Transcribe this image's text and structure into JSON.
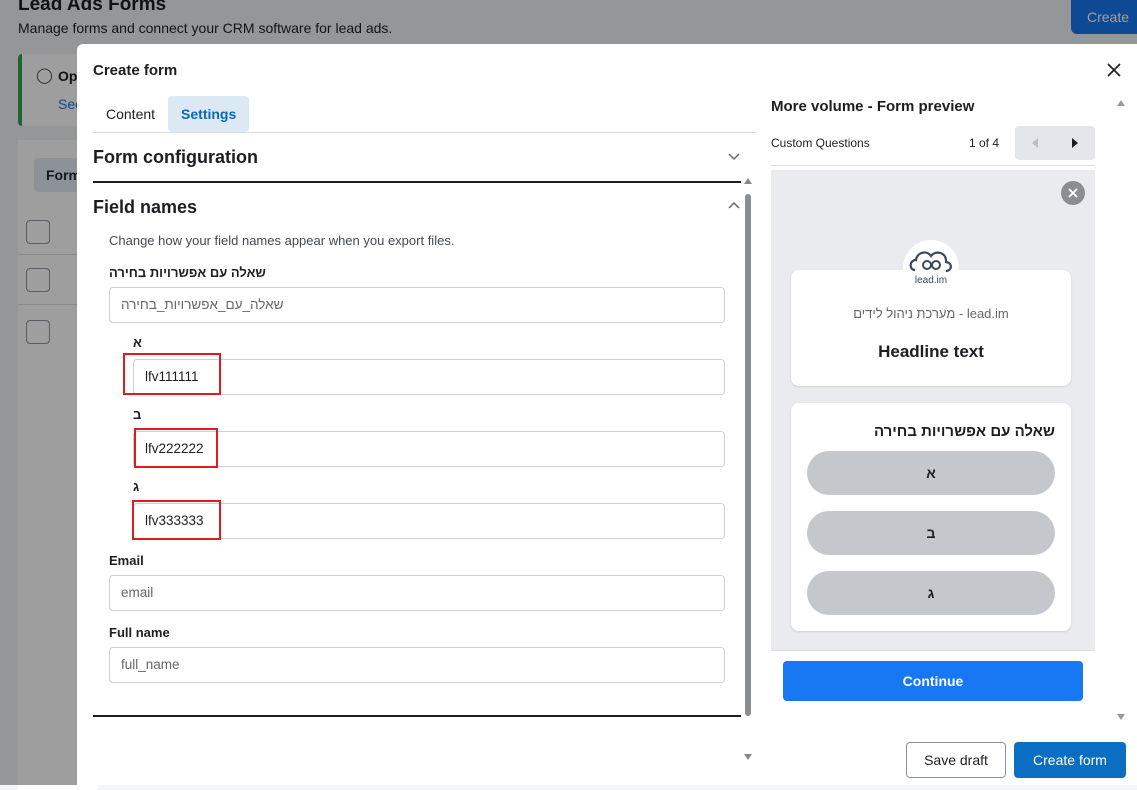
{
  "background": {
    "title": "Lead Ads Forms",
    "subtitle": "Manage forms and connect your CRM software for lead ads.",
    "create_button": "Create",
    "tip_title": "Op",
    "tip_link": "See",
    "table_tab": "Form"
  },
  "modal": {
    "title": "Create form",
    "close_icon": "close-icon",
    "tabs": [
      {
        "label": "Content",
        "active": false
      },
      {
        "label": "Settings",
        "active": true
      }
    ]
  },
  "settings": {
    "form_configuration": "Form configuration",
    "field_names": "Field names",
    "help_text": "Change how your field names appear when you export files.",
    "question": {
      "label": "שאלה עם אפשרויות בחירה",
      "placeholder": "שאלה_עם_אפשרויות_בחירה",
      "options": [
        {
          "label": "א",
          "value": "lfv111111"
        },
        {
          "label": "ב",
          "value": "lfv222222"
        },
        {
          "label": "ג",
          "value": "lfv333333"
        }
      ]
    },
    "email": {
      "label": "Email",
      "placeholder": "email"
    },
    "full_name": {
      "label": "Full name",
      "placeholder": "full_name"
    }
  },
  "preview": {
    "title": "More volume - Form preview",
    "section": "Custom Questions",
    "page": "1 of 4",
    "brand": "מערכת ניהול לידים - lead.im",
    "logo_text": "lead.im",
    "headline": "Headline text",
    "question": "שאלה עם אפשרויות בחירה",
    "choices": [
      "א",
      "ב",
      "ג"
    ],
    "continue": "Continue"
  },
  "footer": {
    "save_draft": "Save draft",
    "create_form": "Create form"
  },
  "colors": {
    "primary": "#1877f2",
    "create_button": "#0a6fc2",
    "highlight": "#e01b1b",
    "active_tab_bg": "#dce9f5"
  }
}
